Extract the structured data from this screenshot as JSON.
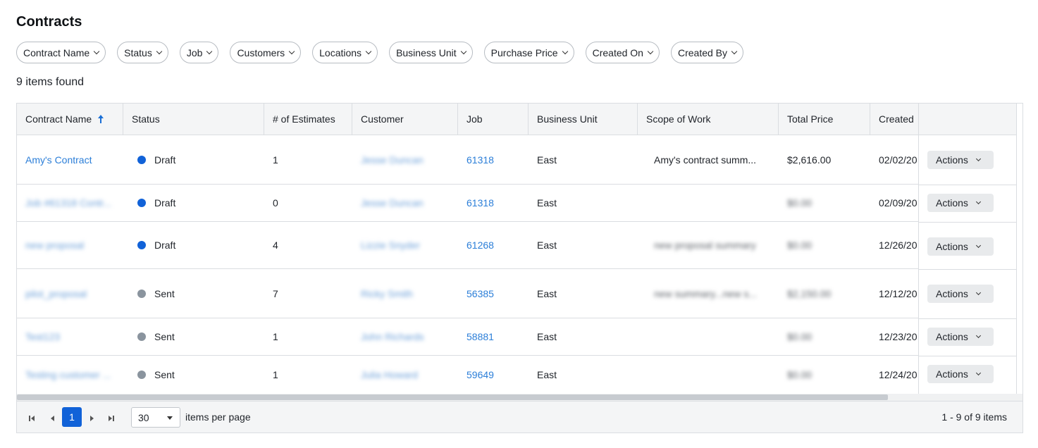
{
  "page": {
    "title": "Contracts",
    "items_found": "9 items found"
  },
  "filters": [
    "Contract Name",
    "Status",
    "Job",
    "Customers",
    "Locations",
    "Business Unit",
    "Purchase Price",
    "Created On",
    "Created By"
  ],
  "columns": [
    "Contract Name",
    "Status",
    "# of Estimates",
    "Customer",
    "Job",
    "Business Unit",
    "Scope of Work",
    "Total Price",
    "Created"
  ],
  "rows": [
    {
      "name": "Amy's Contract",
      "status": "Draft",
      "estimates": "1",
      "customer": "Jesse Duncan",
      "job": "61318",
      "unit": "East",
      "scope": "Amy's contract summ...",
      "price": "$2,616.00",
      "created": "02/02/20"
    },
    {
      "name": "Job #61318 Contr...",
      "status": "Draft",
      "estimates": "0",
      "customer": "Jesse Duncan",
      "job": "61318",
      "unit": "East",
      "scope": "",
      "price": "$0.00",
      "created": "02/09/20"
    },
    {
      "name": "new proposal",
      "status": "Draft",
      "estimates": "4",
      "customer": "Lizzie Snyder",
      "job": "61268",
      "unit": "East",
      "scope": "new proposal summary",
      "price": "$0.00",
      "created": "12/26/20"
    },
    {
      "name": "pilot_proposal",
      "status": "Sent",
      "estimates": "7",
      "customer": "Ricky Smith",
      "job": "56385",
      "unit": "East",
      "scope": "new summary...new s...",
      "price": "$2,150.00",
      "created": "12/12/20"
    },
    {
      "name": "Test123",
      "status": "Sent",
      "estimates": "1",
      "customer": "John Richards",
      "job": "58881",
      "unit": "East",
      "scope": "",
      "price": "$0.00",
      "created": "12/23/20"
    },
    {
      "name": "Testing customer ...",
      "status": "Sent",
      "estimates": "1",
      "customer": "Julia Howard",
      "job": "59649",
      "unit": "East",
      "scope": "",
      "price": "$0.00",
      "created": "12/24/20"
    }
  ],
  "actions_label": "Actions",
  "pager": {
    "current_page": "1",
    "per_page": "30",
    "per_page_label": "items per page",
    "range": "1 - 9 of 9 items"
  },
  "colors": {
    "accent": "#1162d8",
    "link": "#2b7ed8",
    "draft": "#1162d8",
    "sent": "#8a949e"
  }
}
